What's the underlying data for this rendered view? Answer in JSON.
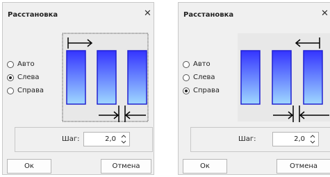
{
  "dialogs": [
    {
      "title": "Расстановка",
      "close_icon": "close-icon",
      "options": [
        "Авто",
        "Слева",
        "Справа"
      ],
      "selected": "Слева",
      "step": {
        "label": "Шаг:",
        "value": "2,0"
      },
      "buttons": {
        "ok": "Ок",
        "cancel": "Отмена"
      }
    },
    {
      "title": "Расстановка",
      "close_icon": "close-icon",
      "options": [
        "Авто",
        "Слева",
        "Справа"
      ],
      "selected": "Справа",
      "step": {
        "label": "Шаг:",
        "value": "2,0"
      },
      "buttons": {
        "ok": "Ок",
        "cancel": "Отмена"
      }
    }
  ],
  "colors": {
    "bar_fill_top": "#3434ff",
    "bar_fill_bottom": "#9fd8ff",
    "bar_stroke": "#2020d0",
    "preview_bg": "#e8e8e8"
  }
}
